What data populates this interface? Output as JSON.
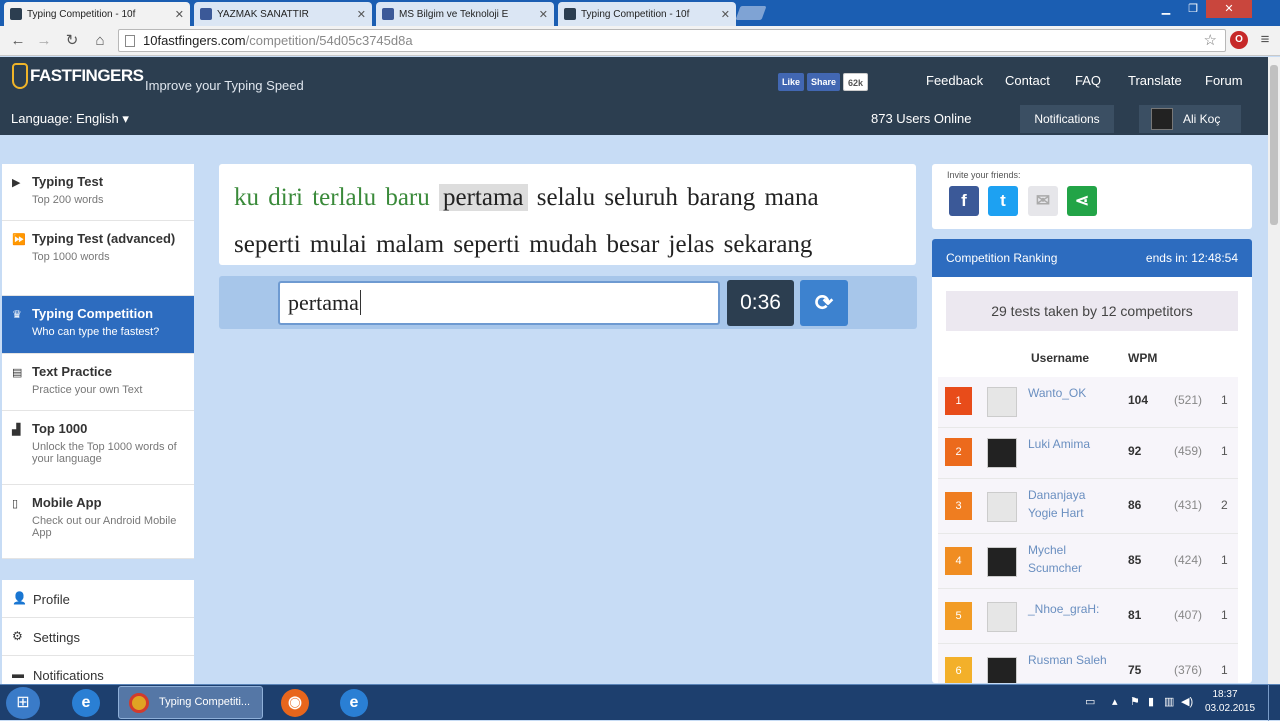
{
  "browser": {
    "tabs": [
      {
        "title": "Typing Competition - 10f",
        "active": true
      },
      {
        "title": "YAZMAK SANATTIR",
        "active": false
      },
      {
        "title": "MS Bilgim ve Teknoloji E",
        "active": false
      },
      {
        "title": "Typing Competition - 10f",
        "active": false
      }
    ],
    "address": {
      "host": "10fastfingers.com",
      "path": "/competition/54d05c3745d8a"
    }
  },
  "header": {
    "logo": "FASTFINGERS",
    "tagline": "Improve your Typing Speed",
    "fb_like": "Like",
    "fb_share": "Share",
    "fb_count": "62k",
    "nav": [
      "Feedback",
      "Contact",
      "FAQ",
      "Translate",
      "Forum"
    ],
    "language": "Language: English",
    "users_online": "873 Users Online",
    "notifications": "Notifications",
    "username": "Ali Koç"
  },
  "sidebar": {
    "items": [
      {
        "title": "Typing Test",
        "subtitle": "Top 200 words",
        "icon": "play-icon"
      },
      {
        "title": "Typing Test (advanced)",
        "subtitle": "Top 1000 words",
        "icon": "fast-forward-icon"
      },
      {
        "title": "Typing Competition",
        "subtitle": "Who can type the fastest?",
        "icon": "trophy-icon"
      },
      {
        "title": "Text Practice",
        "subtitle": "Practice your own Text",
        "icon": "document-icon"
      },
      {
        "title": "Top 1000",
        "subtitle": "Unlock the Top 1000 words of your language",
        "icon": "bar-chart-icon"
      },
      {
        "title": "Mobile App",
        "subtitle": "Check out our Android Mobile App",
        "icon": "mobile-icon"
      }
    ],
    "account": [
      {
        "title": "Profile",
        "icon": "user-icon"
      },
      {
        "title": "Settings",
        "icon": "gear-icon"
      },
      {
        "title": "Notifications",
        "icon": "chat-icon"
      }
    ]
  },
  "test": {
    "line1_done": "ku diri terlalu baru",
    "line1_current": "pertama",
    "line1_rest": "selalu seluruh barang mana",
    "line2": "seperti mulai malam seperti mudah besar jelas sekarang",
    "input_value": "pertama ",
    "timer": "0:36"
  },
  "invite": {
    "label": "Invite your friends:"
  },
  "ranking": {
    "title": "Competition Ranking",
    "ends": "ends in: 12:48:54",
    "summary": "29 tests taken by 12 competitors",
    "col_username": "Username",
    "col_wpm": "WPM",
    "rows": [
      {
        "rank": "1",
        "name": "Wanto_OK",
        "wpm": "104",
        "keys": "(521)",
        "tries": "1",
        "color": "#e84c1a"
      },
      {
        "rank": "2",
        "name": "Luki Amima",
        "wpm": "92",
        "keys": "(459)",
        "tries": "1",
        "color": "#ec6a1c"
      },
      {
        "rank": "3",
        "name": "Dananjaya Yogie Hart",
        "wpm": "86",
        "keys": "(431)",
        "tries": "2",
        "color": "#ef7d20"
      },
      {
        "rank": "4",
        "name": "Mychel Scumcher",
        "wpm": "85",
        "keys": "(424)",
        "tries": "1",
        "color": "#f08d22"
      },
      {
        "rank": "5",
        "name": "_Nhoe_graH:",
        "wpm": "81",
        "keys": "(407)",
        "tries": "1",
        "color": "#f29c25"
      },
      {
        "rank": "6",
        "name": "Rusman Saleh",
        "wpm": "75",
        "keys": "(376)",
        "tries": "1",
        "color": "#f3b02a"
      }
    ]
  },
  "taskbar": {
    "active_window": "Typing Competiti...",
    "time": "18:37",
    "date": "03.02.2015"
  }
}
